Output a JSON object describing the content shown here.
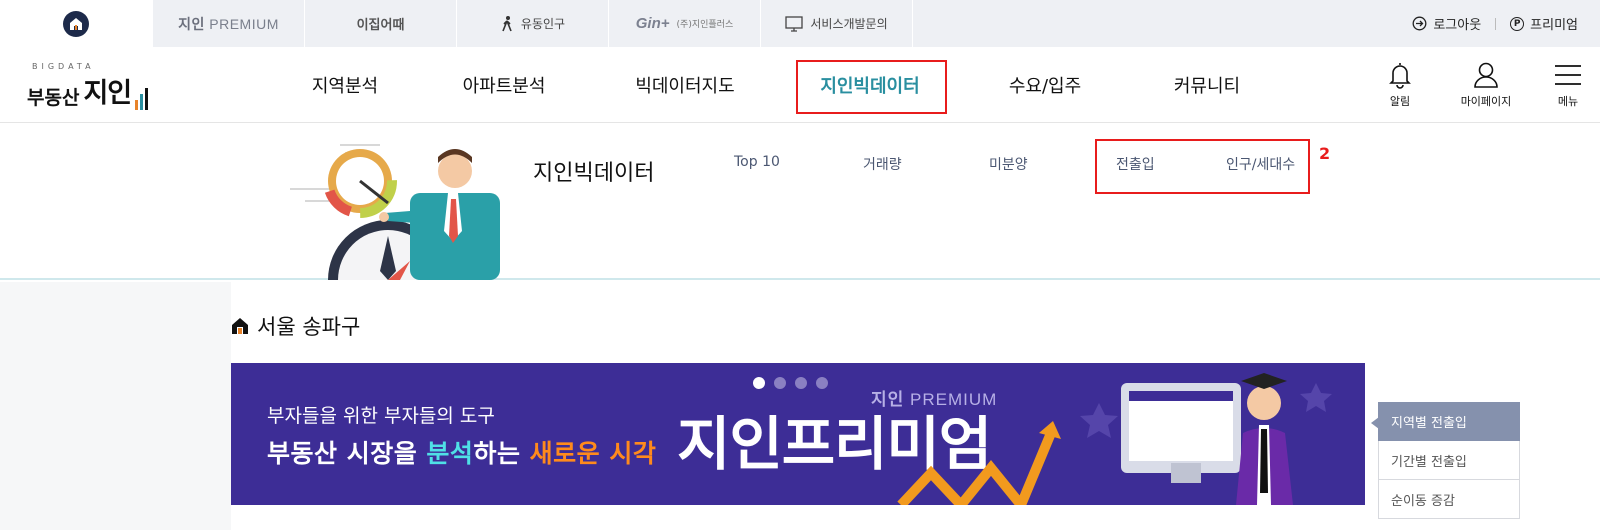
{
  "topbar": {
    "tabs": [
      {
        "name": "home",
        "label": ""
      },
      {
        "name": "premium",
        "label_a": "지인",
        "label_b": "PREMIUM"
      },
      {
        "name": "ijip",
        "label": "이집어때"
      },
      {
        "name": "population",
        "label": "유동인구"
      },
      {
        "name": "ginplus",
        "logo": "Gin+",
        "label": "(주)지인플러스"
      },
      {
        "name": "service",
        "label": "서비스개발문의"
      }
    ],
    "logout": "로그아웃",
    "premium_link": "프리미엄",
    "premium_badge": "P"
  },
  "logo": {
    "tag": "BIGDATA",
    "prefix": "부동산",
    "brand": "지인"
  },
  "nav": {
    "items": [
      "지역분석",
      "아파트분석",
      "빅데이터지도",
      "지인빅데이터",
      "수요/입주",
      "커뮤니티"
    ],
    "active_index": 3,
    "alarm": "알림",
    "mypage": "마이페이지",
    "menu": "메뉴"
  },
  "subhead": {
    "title": "지인빅데이터",
    "tabs": [
      "Top 10",
      "거래량",
      "미분양",
      "전출입",
      "인구/세대수"
    ],
    "annotation": "2"
  },
  "content": {
    "region": "서울 송파구",
    "banner": {
      "subtitle": "부자들을 위한 부자들의 도구",
      "main_a": "부동산 시장을 ",
      "main_b": "분석",
      "main_c": "하는 ",
      "main_d": "새로운 시각",
      "premium_a": "지인",
      "premium_b": "PREMIUM",
      "title": "지인프리미엄",
      "active_dot": 0,
      "dot_count": 4
    },
    "side_menu": [
      "지역별 전출입",
      "기간별 전출입",
      "순이동 증감"
    ],
    "side_active": 0
  },
  "colors": {
    "accent": "#2a8fa0",
    "highlight_box": "#e81c1c",
    "banner_bg": "#3d2d96",
    "side_active": "#8591ad"
  }
}
